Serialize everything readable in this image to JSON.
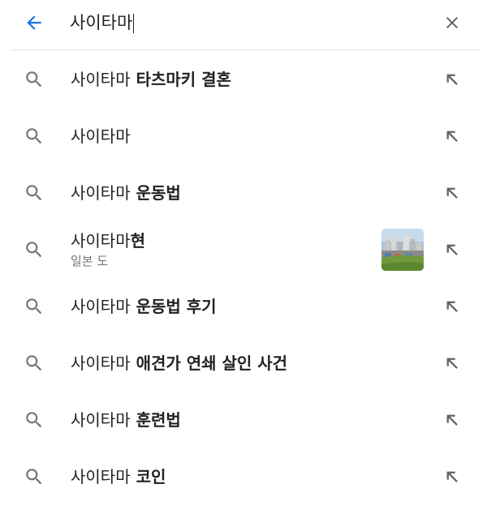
{
  "search": {
    "query": "사이타마",
    "back_icon": "arrow-back-icon",
    "clear_icon": "close-icon"
  },
  "colors": {
    "accent": "#1a73e8",
    "text": "#202124",
    "secondary": "#70757a",
    "icon_gray": "#70757a",
    "divider": "#e3e3e3"
  },
  "suggestions": [
    {
      "prefix": "사이타마",
      "suffix": " 타츠마키 결혼",
      "sub": "",
      "has_thumbnail": false
    },
    {
      "prefix": "사이타마",
      "suffix": "",
      "sub": "",
      "has_thumbnail": false
    },
    {
      "prefix": "사이타마",
      "suffix": " 운동법",
      "sub": "",
      "has_thumbnail": false
    },
    {
      "prefix": "사이타마",
      "suffix": "현",
      "sub": "일본 도",
      "has_thumbnail": true
    },
    {
      "prefix": "사이타마",
      "suffix": " 운동법 후기",
      "sub": "",
      "has_thumbnail": false
    },
    {
      "prefix": "사이타마",
      "suffix": " 애견가 연쇄 살인 사건",
      "sub": "",
      "has_thumbnail": false
    },
    {
      "prefix": "사이타마",
      "suffix": " 훈련법",
      "sub": "",
      "has_thumbnail": false
    },
    {
      "prefix": "사이타마",
      "suffix": " 코인",
      "sub": "",
      "has_thumbnail": false
    }
  ]
}
